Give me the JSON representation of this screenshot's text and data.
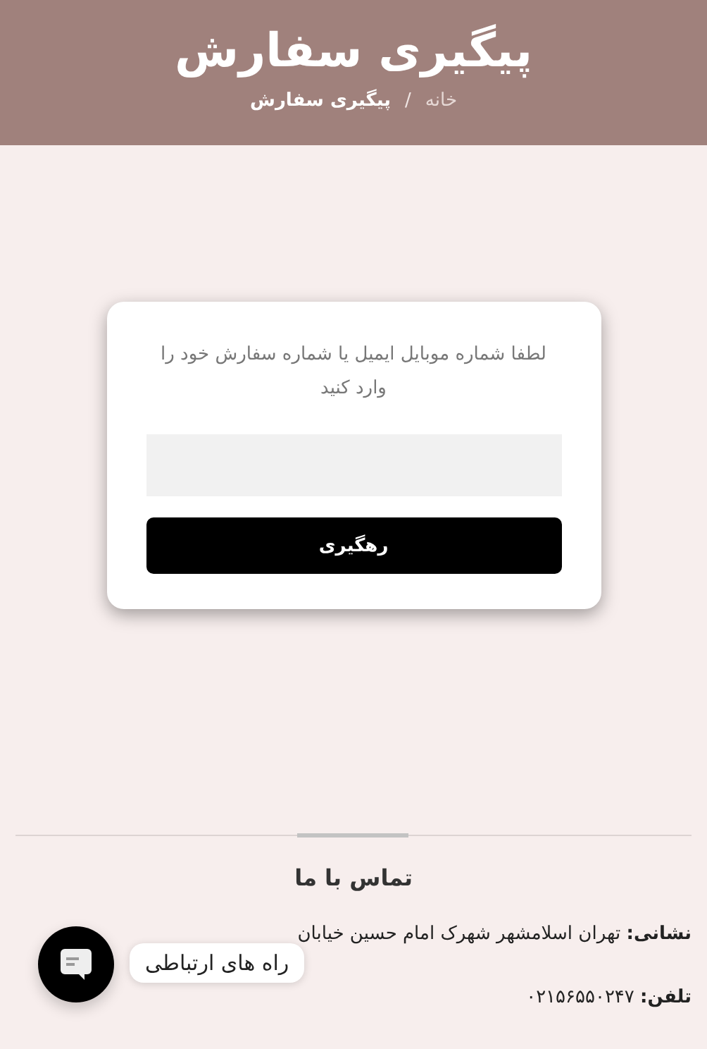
{
  "header": {
    "title": "پیگیری سفارش",
    "breadcrumb": [
      {
        "label": "خانه",
        "current": false
      },
      {
        "label": "پیگیری سفارش",
        "current": true
      }
    ],
    "separator": "/"
  },
  "tracking_card": {
    "prompt": "لطفا شماره موبایل ایمیل یا شماره سفارش خود را وارد کنید",
    "button": "رهگیری"
  },
  "footer": {
    "title": "تماس با ما",
    "address": {
      "label": "نشانی:",
      "value": "تهران اسلامشهر شهرک امام حسین خیابان"
    },
    "phone": {
      "label": "تلفن:",
      "value": "۰۲۱۵۶۵۵۰۲۴۷"
    }
  },
  "chat_widget": {
    "tooltip": "راه های ارتباطی"
  }
}
